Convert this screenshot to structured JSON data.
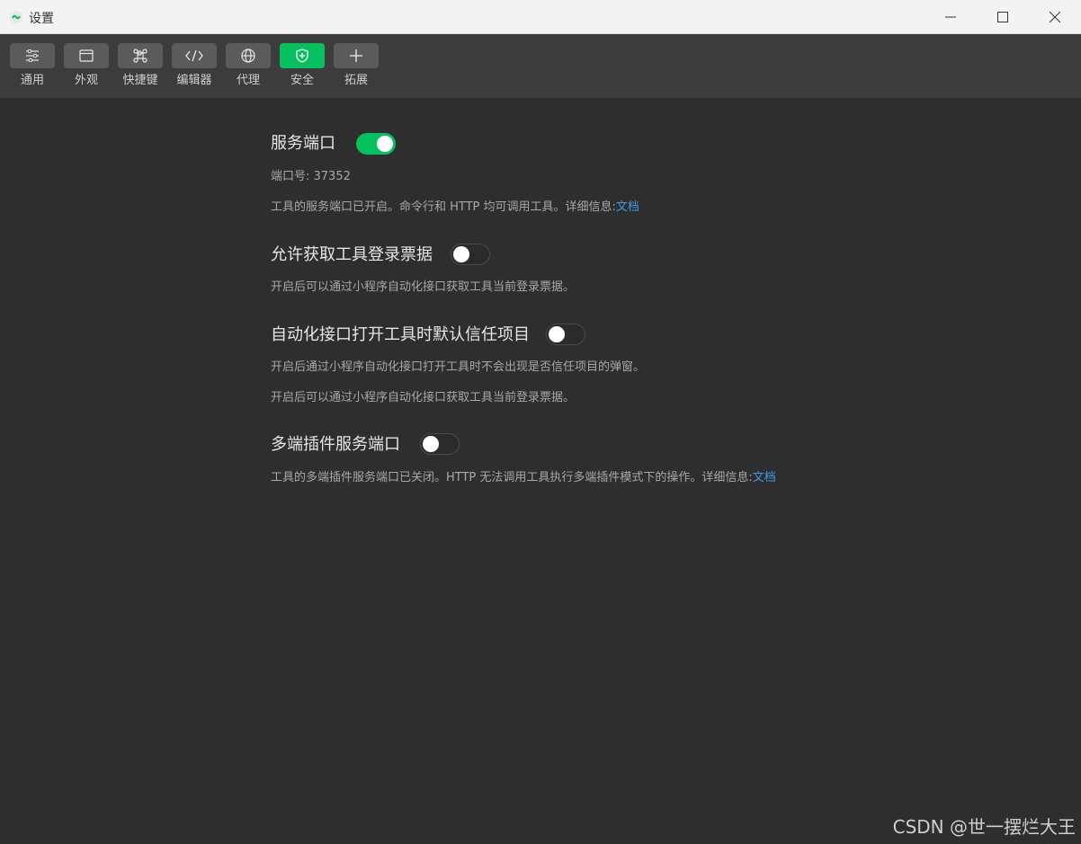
{
  "window": {
    "title": "设置"
  },
  "toolbar": {
    "items": [
      {
        "label": "通用",
        "icon": "sliders-icon"
      },
      {
        "label": "外观",
        "icon": "window-icon"
      },
      {
        "label": "快捷键",
        "icon": "command-key-icon"
      },
      {
        "label": "编辑器",
        "icon": "code-icon"
      },
      {
        "label": "代理",
        "icon": "globe-icon"
      },
      {
        "label": "安全",
        "icon": "shield-icon",
        "active": true
      },
      {
        "label": "拓展",
        "icon": "plus-icon"
      }
    ]
  },
  "settings": {
    "service_port": {
      "title": "服务端口",
      "enabled": true,
      "port_label": "端口号: 37352",
      "desc": "工具的服务端口已开启。命令行和 HTTP 均可调用工具。详细信息:",
      "link": "文档"
    },
    "allow_ticket": {
      "title": "允许获取工具登录票据",
      "enabled": false,
      "desc": "开启后可以通过小程序自动化接口获取工具当前登录票据。"
    },
    "auto_trust": {
      "title": "自动化接口打开工具时默认信任项目",
      "enabled": false,
      "desc1": "开启后通过小程序自动化接口打开工具时不会出现是否信任项目的弹窗。",
      "desc2": "开启后可以通过小程序自动化接口获取工具当前登录票据。"
    },
    "multi_plugin_port": {
      "title": "多端插件服务端口",
      "enabled": false,
      "desc": "工具的多端插件服务端口已关闭。HTTP 无法调用工具执行多端插件模式下的操作。详细信息:",
      "link": "文档"
    }
  },
  "watermark": "CSDN @世一摆烂大王",
  "colors": {
    "accent": "#07c160",
    "link": "#3d9be9",
    "background": "#2e2e2e"
  }
}
